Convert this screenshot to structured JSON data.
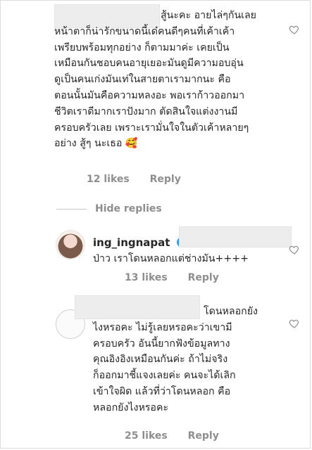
{
  "comments": [
    {
      "text": "สู้นะคะ อายไล่ๆกันเลย\nหน้าตาก็น่ารักขนาดนี้เด๋คนดีๆคนที่เค้าเค้า\nเพรียบพร้อมทุกอย่าง ก็ตามมาค่ะ เคยเป็น\nเหมือนกันชอบคนอายุเยอะมันดูมีความอบอุ่น\nดูเป็นคนเก่งมันเท่ในสายตาเรามากนะ คือ\nตอนนั้นมันคือความหลงอะ พอเราก้าวออกมา\nชีวิตเราดีมากเราปังมาก ตัดสินใจแต่งงานมี\nครอบครัวเลย เพราะเรามั่นใจในตัวเค้าหลายๆ\nอย่าง สู้ๆ นะเธอ 🥰",
      "likes": "12 likes",
      "reply": "Reply"
    }
  ],
  "hide_replies": "Hide replies",
  "reply_1": {
    "username": "ing_ingnapat",
    "text": "ป่าว เราโดนหลอกแต่ช่างมัน++++",
    "likes": "13 likes",
    "reply": "Reply"
  },
  "reply_2": {
    "text": "โดนหลอกยัง\nไงหรอคะ ไม่รู้เลยหรอคะว่าเขามี\nครอบครัว อันนี้ยากฟังข้อมูลทาง\nคุณอิงอิงเหมือนกันค่ะ ถ้าไม่จริง\nก็ออกมาชี้แจงเลยค่ะ คนจะได้เลิก\nเข้าใจผิด แล้วที่ว่าโดนหลอก คือ\nหลอกยังไงหรอคะ",
    "likes": "25 likes",
    "reply": "Reply"
  },
  "icons": {
    "like": "heart-icon",
    "verified": "verified-badge-icon"
  }
}
